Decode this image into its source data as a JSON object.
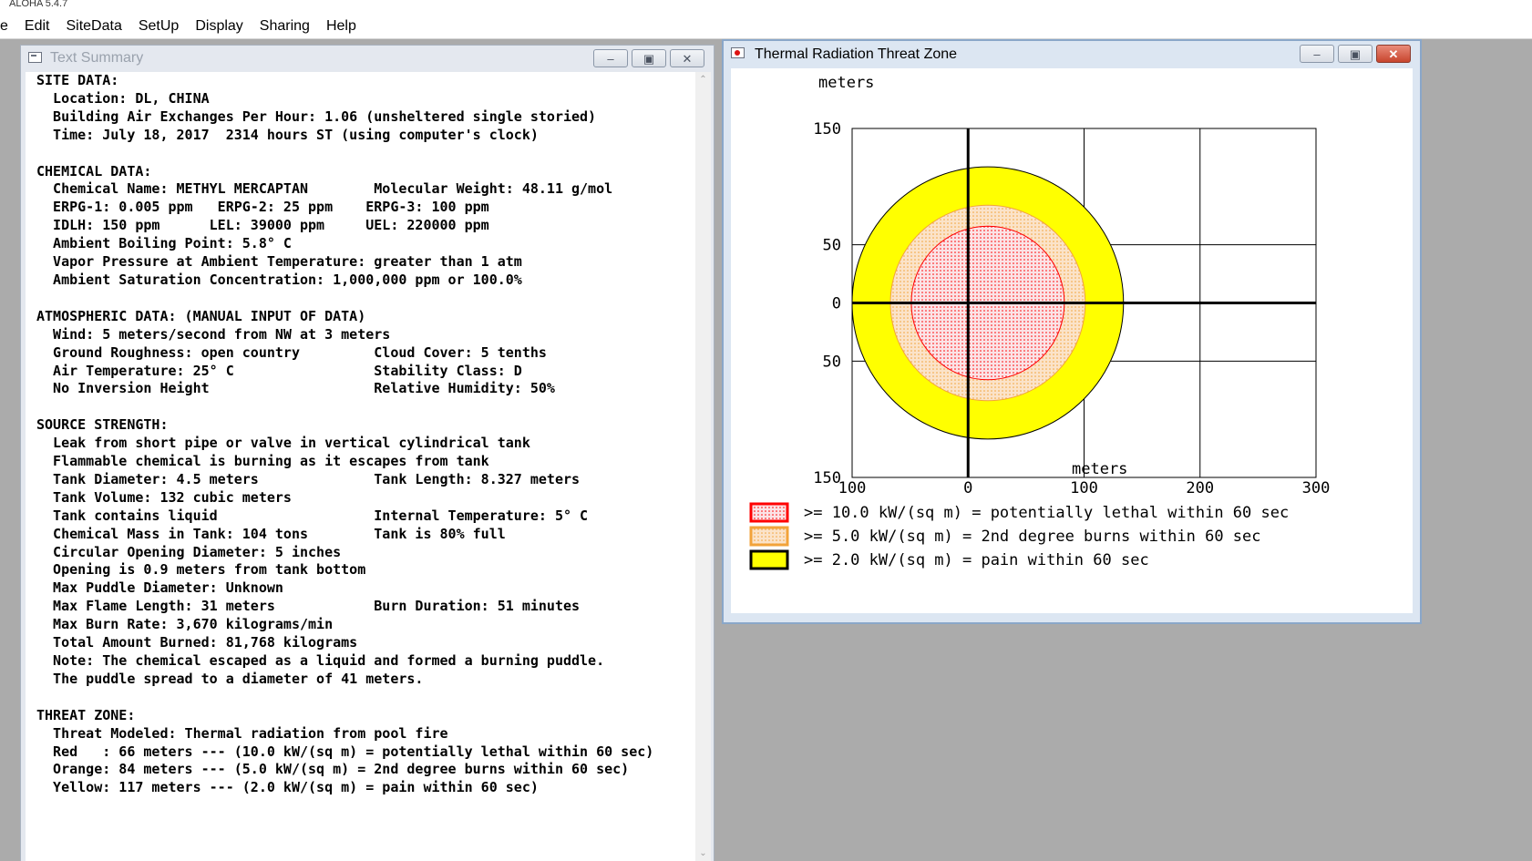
{
  "app": {
    "title": "ALOHA 5.4.7"
  },
  "menu": [
    "e",
    "Edit",
    "SiteData",
    "SetUp",
    "Display",
    "Sharing",
    "Help"
  ],
  "text_summary": {
    "title": "Text Summary",
    "lines": [
      "SITE DATA:",
      "  Location: DL, CHINA",
      "  Building Air Exchanges Per Hour: 1.06 (unsheltered single storied)",
      "  Time: July 18, 2017  2314 hours ST (using computer's clock)",
      "",
      "CHEMICAL DATA:",
      "  Chemical Name: METHYL MERCAPTAN        Molecular Weight: 48.11 g/mol",
      "  ERPG-1: 0.005 ppm   ERPG-2: 25 ppm    ERPG-3: 100 ppm",
      "  IDLH: 150 ppm      LEL: 39000 ppm     UEL: 220000 ppm",
      "  Ambient Boiling Point: 5.8° C",
      "  Vapor Pressure at Ambient Temperature: greater than 1 atm",
      "  Ambient Saturation Concentration: 1,000,000 ppm or 100.0%",
      "",
      "ATMOSPHERIC DATA: (MANUAL INPUT OF DATA)",
      "  Wind: 5 meters/second from NW at 3 meters",
      "  Ground Roughness: open country         Cloud Cover: 5 tenths",
      "  Air Temperature: 25° C                 Stability Class: D",
      "  No Inversion Height                    Relative Humidity: 50%",
      "",
      "SOURCE STRENGTH:",
      "  Leak from short pipe or valve in vertical cylindrical tank",
      "  Flammable chemical is burning as it escapes from tank",
      "  Tank Diameter: 4.5 meters              Tank Length: 8.327 meters",
      "  Tank Volume: 132 cubic meters",
      "  Tank contains liquid                   Internal Temperature: 5° C",
      "  Chemical Mass in Tank: 104 tons        Tank is 80% full",
      "  Circular Opening Diameter: 5 inches",
      "  Opening is 0.9 meters from tank bottom",
      "  Max Puddle Diameter: Unknown",
      "  Max Flame Length: 31 meters            Burn Duration: 51 minutes",
      "  Max Burn Rate: 3,670 kilograms/min",
      "  Total Amount Burned: 81,768 kilograms",
      "  Note: The chemical escaped as a liquid and formed a burning puddle.",
      "  The puddle spread to a diameter of 41 meters.",
      "",
      "THREAT ZONE:",
      "  Threat Modeled: Thermal radiation from pool fire",
      "  Red   : 66 meters --- (10.0 kW/(sq m) = potentially lethal within 60 sec)",
      "  Orange: 84 meters --- (5.0 kW/(sq m) = 2nd degree burns within 60 sec)",
      "  Yellow: 117 meters --- (2.0 kW/(sq m) = pain within 60 sec)"
    ]
  },
  "threat_zone": {
    "title": "Thermal Radiation Threat Zone",
    "chart_data": {
      "type": "area",
      "ylabel": "meters",
      "xlabel": "meters",
      "xlim": [
        -100,
        300
      ],
      "ylim": [
        -150,
        150
      ],
      "x_ticks": [
        -100,
        0,
        100,
        200,
        300
      ],
      "x_tick_labels": [
        "100",
        "0",
        "100",
        "200",
        "300"
      ],
      "y_ticks": [
        150,
        50,
        0,
        -50,
        -150
      ],
      "y_tick_labels": [
        "150",
        "50",
        "0",
        "50",
        "150"
      ],
      "grid": true,
      "zones": [
        {
          "name": "yellow",
          "radius_m": 117,
          "color": "#ffff00",
          "pattern": "solid"
        },
        {
          "name": "orange",
          "radius_m": 84,
          "color": "#f2a33a",
          "pattern": "dotted"
        },
        {
          "name": "red",
          "radius_m": 66,
          "color": "#ff0000",
          "pattern": "dotted"
        }
      ],
      "center_x": 17,
      "center_y": 0,
      "legend": [
        {
          "swatch": "red",
          "color": "#ff0000",
          "label": ">= 10.0 kW/(sq m) = potentially lethal within 60 sec"
        },
        {
          "swatch": "orange",
          "color": "#f2a33a",
          "label": ">= 5.0 kW/(sq m) = 2nd degree burns within 60 sec"
        },
        {
          "swatch": "yellow",
          "color": "#ffff00",
          "label": ">= 2.0 kW/(sq m) = pain within 60 sec"
        }
      ],
      "legend_position": "bottom-left"
    }
  },
  "colors": {
    "desktop": "#ababab",
    "yellow_zone": "#ffff00",
    "orange_zone": "#f2a33a",
    "red_zone": "#ff0000"
  }
}
